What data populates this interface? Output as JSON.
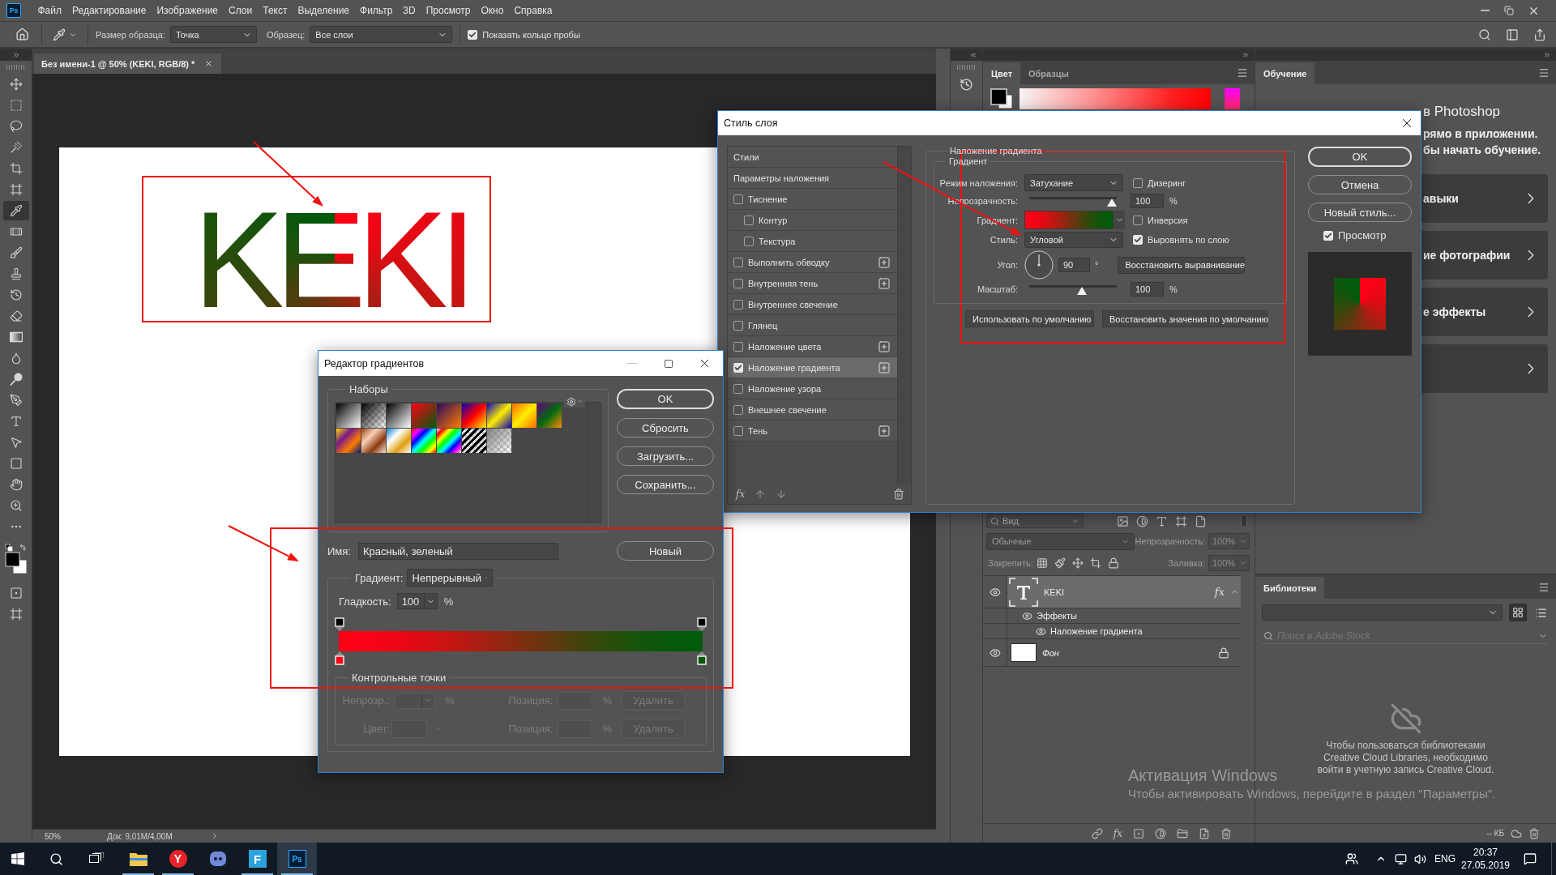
{
  "menu_bar": {
    "logo": "Ps",
    "items": [
      "Файл",
      "Редактирование",
      "Изображение",
      "Слои",
      "Текст",
      "Выделение",
      "Фильтр",
      "3D",
      "Просмотр",
      "Окно",
      "Справка"
    ]
  },
  "options_bar": {
    "sample_size_label": "Размер образца:",
    "sample_size": "Точка",
    "sample_label": "Образец:",
    "sample": "Все слои",
    "ring": {
      "label": "Показать кольцо пробы",
      "checked": true
    }
  },
  "toolbar": {
    "tools": [
      {
        "selected": false
      },
      {
        "selected": false
      },
      {
        "selected": false
      },
      {
        "selected": false
      },
      {
        "selected": false
      },
      {
        "selected": false
      },
      {
        "selected": true
      },
      {
        "selected": false
      },
      {
        "selected": false
      },
      {
        "selected": false
      },
      {
        "selected": false
      },
      {
        "selected": false
      },
      {
        "selected": false
      },
      {
        "selected": false
      },
      {
        "selected": false
      },
      {
        "selected": false
      },
      {
        "selected": false
      },
      {
        "selected": false
      },
      {
        "selected": false
      },
      {
        "selected": false
      },
      {
        "selected": false
      },
      {
        "selected": false
      }
    ]
  },
  "document": {
    "tab": "Без имени-1 @ 50% (KEKI, RGB/8) *",
    "text": "KEKI"
  },
  "status_bar": {
    "zoom": "50%",
    "info": "Док: 9,01M/4,00M"
  },
  "color_panel": {
    "tabs": [
      {
        "label": "Цвет",
        "selected": true
      },
      {
        "label": "Образцы",
        "selected": false
      }
    ]
  },
  "learning_panel": {
    "tab": "Обучение",
    "heading": "в Photoshop",
    "intro_lines": [
      "рямо в приложении.",
      "бы начать обучение."
    ],
    "cards": [
      {
        "kind": "titled",
        "title": "авыки"
      },
      {
        "kind": "titled",
        "title": "ие фотографии"
      },
      {
        "kind": "titled",
        "title": "е эффекты"
      },
      {
        "kind": "untitled"
      }
    ]
  },
  "layers_panel": {
    "filter": "Вид",
    "blend": "Обычные",
    "opacity_label": "Непрозрачность:",
    "opacity": "100%",
    "lock_label": "Закрепить:",
    "fill_label": "Заливка:",
    "fill": "100%",
    "layers": [
      {
        "kind": "text",
        "name": "KEKI",
        "visible": true,
        "selected": true,
        "locked": false,
        "effects_badge": "fx",
        "expanded": true,
        "children": [
          {
            "name": "Эффекты",
            "visible": true,
            "children": [
              {
                "name": "Наложение градиента",
                "visible": true
              }
            ]
          }
        ]
      },
      {
        "kind": "background",
        "name": "Фон",
        "visible": true,
        "selected": false,
        "locked": true
      }
    ],
    "footer_badge": "fx"
  },
  "libraries_panel": {
    "tab": "Библиотеки",
    "views": [
      {
        "selected": true
      },
      {
        "selected": false
      }
    ],
    "search_placeholder": "Поиск в Adobe Stock",
    "message_lines": [
      "Чтобы пользоваться библиотеками",
      "Creative Cloud Libraries, необходимо",
      "войти в учетную запись Creative Cloud."
    ],
    "size": "-- КБ"
  },
  "layer_style": {
    "title": "Стиль слоя",
    "styles": [
      {
        "kind": "header",
        "label": "Стили",
        "selected": false
      },
      {
        "kind": "header",
        "label": "Параметры наложения",
        "selected": false
      },
      {
        "kind": "effect",
        "label": "Тиснение",
        "checked": false,
        "selected": false,
        "addable": false
      },
      {
        "kind": "sub",
        "label": "Контур",
        "checked": false,
        "selected": false
      },
      {
        "kind": "sub",
        "label": "Текстура",
        "checked": false,
        "selected": false
      },
      {
        "kind": "effect",
        "label": "Выполнить обводку",
        "checked": false,
        "selected": false,
        "addable": true
      },
      {
        "kind": "effect",
        "label": "Внутренняя тень",
        "checked": false,
        "selected": false,
        "addable": true
      },
      {
        "kind": "effect",
        "label": "Внутреннее свечение",
        "checked": false,
        "selected": false,
        "addable": false
      },
      {
        "kind": "effect",
        "label": "Глянец",
        "checked": false,
        "selected": false,
        "addable": false
      },
      {
        "kind": "effect",
        "label": "Наложение цвета",
        "checked": false,
        "selected": false,
        "addable": true
      },
      {
        "kind": "effect",
        "label": "Наложение градиента",
        "checked": true,
        "selected": true,
        "addable": true
      },
      {
        "kind": "effect",
        "label": "Наложение узора",
        "checked": false,
        "selected": false,
        "addable": false
      },
      {
        "kind": "effect",
        "label": "Внешнее свечение",
        "checked": false,
        "selected": false,
        "addable": false
      },
      {
        "kind": "effect",
        "label": "Тень",
        "checked": false,
        "selected": false,
        "addable": true
      }
    ],
    "footer_badge": "fx",
    "section": "Наложение градиента",
    "group": "Градиент",
    "blend_mode": {
      "label": "Режим наложения:",
      "value": "Затухание"
    },
    "dither": {
      "label": "Дизеринг",
      "checked": false
    },
    "opacity": {
      "label": "Непрозрачность:",
      "level": 1,
      "value": "100",
      "unit": "%"
    },
    "gradient_label": "Градиент:",
    "reverse": {
      "label": "Инверсия",
      "checked": false
    },
    "style": {
      "label": "Стиль:",
      "value": "Угловой"
    },
    "align": {
      "label": "Выровнять по слою",
      "checked": true
    },
    "angle": {
      "label": "Угол:",
      "value": "90",
      "unit": "°"
    },
    "reset_alignment": "Восстановить выравнивание",
    "scale": {
      "label": "Масштаб:",
      "level": 0.61,
      "value": "100",
      "unit": "%"
    },
    "defaults": [
      "Использовать по умолчанию",
      "Восстановить значения по умолчанию"
    ],
    "actions": [
      {
        "label": "OK",
        "default": true
      },
      {
        "label": "Отмена",
        "default": false
      },
      {
        "label": "Новый стиль...",
        "default": false
      }
    ],
    "preview": {
      "label": "Просмотр",
      "checked": true
    }
  },
  "gradient_editor": {
    "title": "Редактор градиентов",
    "presets_title": "Наборы",
    "actions": [
      {
        "label": "OK",
        "default": true
      },
      {
        "label": "Сбросить",
        "default": false
      },
      {
        "label": "Загрузить...",
        "default": false
      },
      {
        "label": "Сохранить...",
        "default": false
      }
    ],
    "name": {
      "label": "Имя:",
      "value": "Красный, зеленый"
    },
    "new_button": "Новый",
    "type": {
      "label": "Градиент:",
      "value": "Непрерывный"
    },
    "smoothness": {
      "label": "Гладкость:",
      "value": "100",
      "unit": "%"
    },
    "opacity_stops": [
      {
        "color": "#000000"
      },
      {
        "color": "#000000"
      }
    ],
    "color_stops": [
      {
        "color": "#ff0015"
      },
      {
        "color": "#005b0b"
      }
    ],
    "stops_title": "Контрольные точки",
    "stop_fields": [
      {
        "kind": "number",
        "label": "Непрозр.:",
        "unit": "%",
        "position_label": "Позиция:",
        "position_unit": "%",
        "delete": "Удалить",
        "disabled": true
      },
      {
        "kind": "swatch",
        "label": "Цвет:",
        "position_label": "Позиция:",
        "position_unit": "%",
        "delete": "Удалить",
        "disabled": true
      }
    ]
  },
  "taskbar": {
    "apps": [
      {
        "running": true,
        "selected": false
      },
      {
        "label": "Y",
        "running": true,
        "selected": false
      },
      {
        "running": false,
        "selected": false
      },
      {
        "label": "F",
        "running": true,
        "selected": false
      },
      {
        "label": "Ps",
        "running": true,
        "selected": true
      }
    ],
    "language": "ENG",
    "time": "20:37",
    "date": "27.05.2019"
  },
  "windows_notice": {
    "title": "Активация Windows",
    "text": "Чтобы активировать Windows, перейдите в раздел \"Параметры\"."
  },
  "annotations": [
    {
      "kind": "arrow"
    },
    {
      "kind": "frame"
    },
    {
      "kind": "arrow"
    },
    {
      "kind": "frame"
    },
    {
      "kind": "arrow"
    },
    {
      "kind": "frame"
    }
  ]
}
